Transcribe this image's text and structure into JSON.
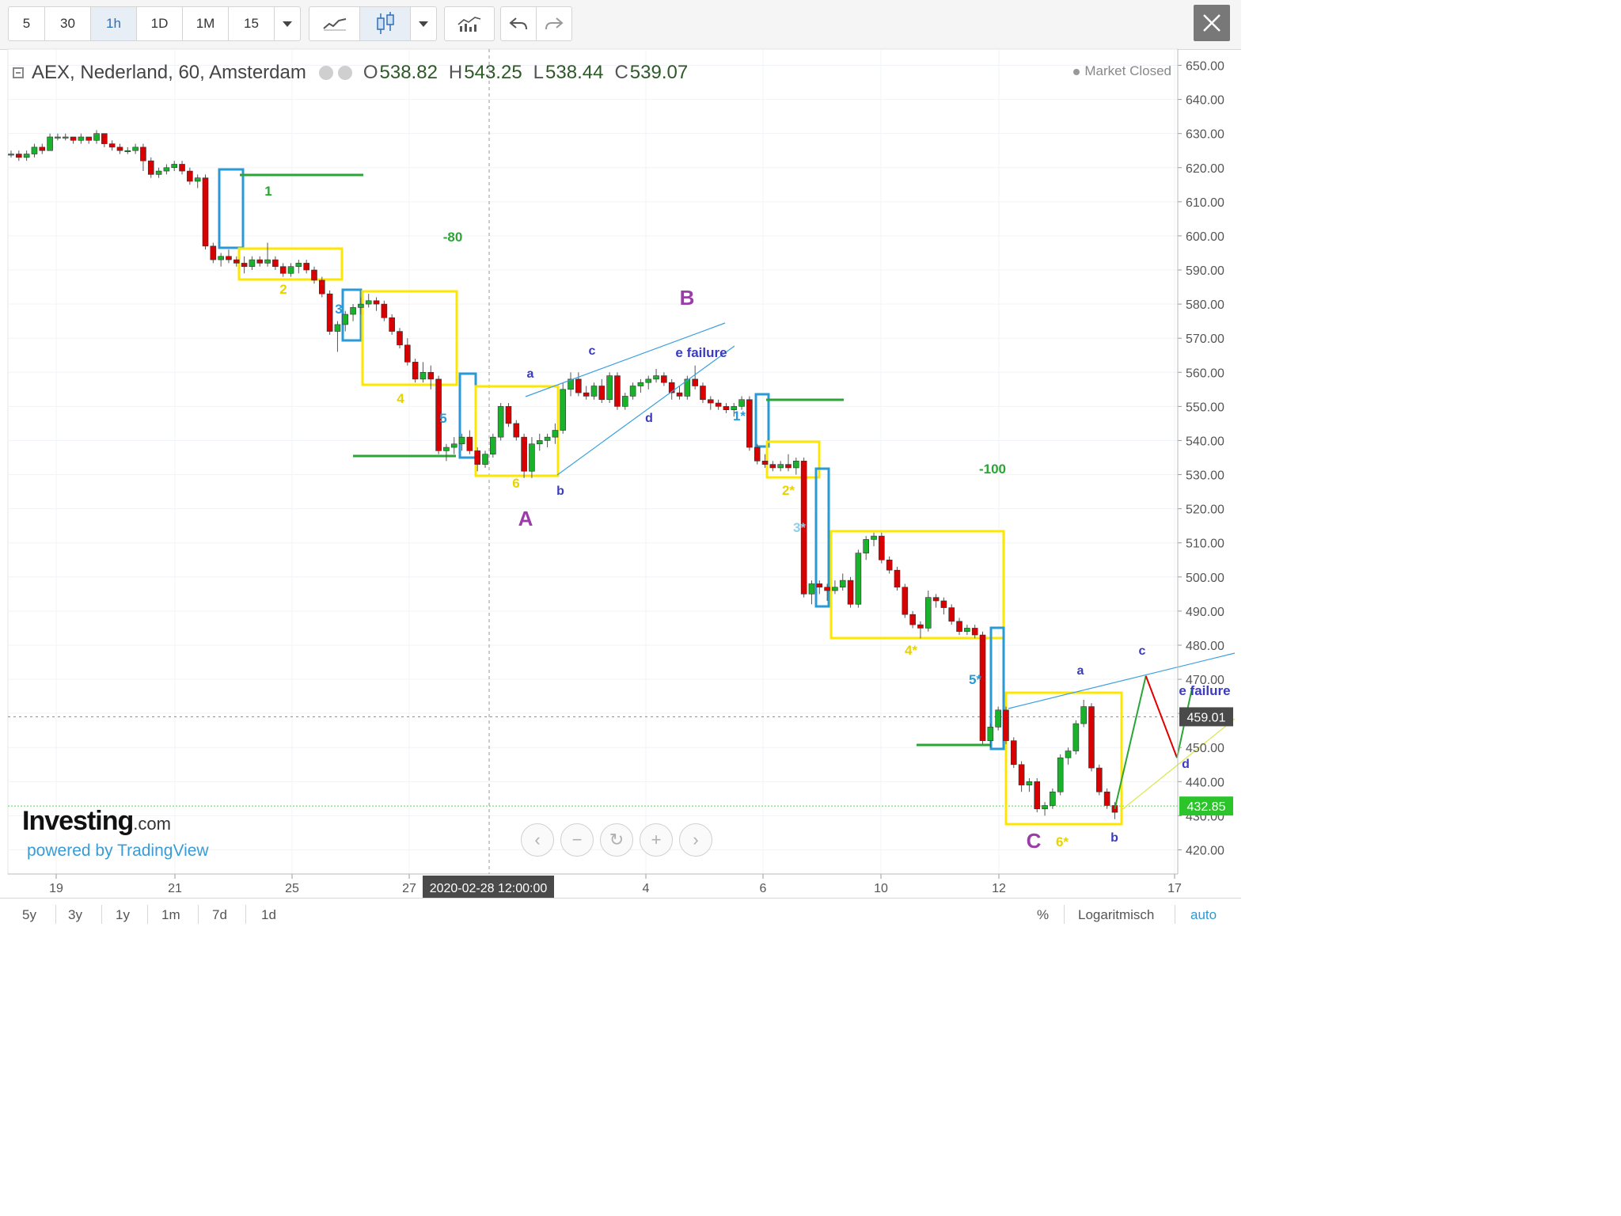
{
  "toolbar": {
    "intervals": [
      "5",
      "30",
      "1h",
      "1D",
      "1M",
      "15"
    ],
    "active_interval": "1h"
  },
  "legend": {
    "title": "AEX, Nederland, 60, Amsterdam",
    "open_label": "O",
    "open": "538.82",
    "high_label": "H",
    "high": "543.25",
    "low_label": "L",
    "low": "538.44",
    "close_label": "C",
    "close": "539.07"
  },
  "status": "Market Closed",
  "branding": {
    "name": "Investing",
    "domain": ".com",
    "powered": "powered by TradingView"
  },
  "bottom": {
    "ranges": [
      "5y",
      "3y",
      "1y",
      "1m",
      "7d",
      "1d"
    ],
    "percent": "%",
    "log": "Logaritmisch",
    "auto": "auto"
  },
  "colors": {
    "up": "#19b22b",
    "down": "#d80000",
    "wave_box": "#ffe600",
    "impulse_box": "#2a9ad6",
    "target_line": "#2aa536"
  },
  "chart_data": {
    "type": "candlestick",
    "y_axis": {
      "min": 415,
      "max": 655,
      "ticks": [
        "650.00",
        "640.00",
        "630.00",
        "620.00",
        "610.00",
        "600.00",
        "590.00",
        "580.00",
        "570.00",
        "560.00",
        "550.00",
        "540.00",
        "530.00",
        "520.00",
        "510.00",
        "500.00",
        "490.00",
        "480.00",
        "470.00",
        "460.00",
        "450.00",
        "440.00",
        "430.00",
        "420.00"
      ],
      "log_scale": true,
      "grid": true
    },
    "x_axis": {
      "ticks": [
        "19",
        "21",
        "25",
        "27",
        "4",
        "6",
        "10",
        "12",
        "17"
      ],
      "crosshair_label": "2020-02-28 12:00:00"
    },
    "price_labels": {
      "last": "459.01",
      "marker": "432.85"
    },
    "candles": [
      [
        0,
        624,
        625,
        623,
        624
      ],
      [
        1,
        624,
        625,
        622,
        623
      ],
      [
        2,
        623,
        625,
        622,
        624
      ],
      [
        3,
        624,
        627,
        623,
        626
      ],
      [
        4,
        626,
        627,
        624,
        625
      ],
      [
        5,
        625,
        630,
        625,
        629
      ],
      [
        6,
        629,
        630,
        628,
        629
      ],
      [
        7,
        629,
        630,
        628,
        629
      ],
      [
        8,
        629,
        629,
        627,
        628
      ],
      [
        9,
        628,
        630,
        627,
        629
      ],
      [
        10,
        629,
        629,
        627,
        628
      ],
      [
        11,
        628,
        631,
        627,
        630
      ],
      [
        12,
        630,
        630,
        626,
        627
      ],
      [
        13,
        627,
        628,
        625,
        626
      ],
      [
        14,
        626,
        627,
        624,
        625
      ],
      [
        15,
        625,
        626,
        624,
        625
      ],
      [
        16,
        625,
        627,
        624,
        626
      ],
      [
        17,
        626,
        627,
        619,
        622
      ],
      [
        18,
        622,
        623,
        617,
        618
      ],
      [
        19,
        618,
        620,
        617,
        619
      ],
      [
        20,
        619,
        621,
        618,
        620
      ],
      [
        21,
        620,
        622,
        619,
        621
      ],
      [
        22,
        621,
        622,
        618,
        619
      ],
      [
        23,
        619,
        620,
        615,
        616
      ],
      [
        24,
        616,
        618,
        614,
        617
      ],
      [
        25,
        617,
        618,
        596,
        597
      ],
      [
        26,
        597,
        598,
        592,
        593
      ],
      [
        27,
        593,
        595,
        591,
        594
      ],
      [
        28,
        594,
        596,
        592,
        593
      ],
      [
        29,
        593,
        594,
        591,
        592
      ],
      [
        30,
        592,
        594,
        589,
        591
      ],
      [
        31,
        591,
        594,
        590,
        593
      ],
      [
        32,
        593,
        594,
        591,
        592
      ],
      [
        33,
        592,
        598,
        591,
        593
      ],
      [
        34,
        593,
        594,
        590,
        591
      ],
      [
        35,
        591,
        592,
        588,
        589
      ],
      [
        36,
        589,
        592,
        588,
        591
      ],
      [
        37,
        591,
        593,
        589,
        592
      ],
      [
        38,
        592,
        593,
        589,
        590
      ],
      [
        39,
        590,
        591,
        586,
        587
      ],
      [
        40,
        587,
        588,
        582,
        583
      ],
      [
        41,
        583,
        584,
        571,
        572
      ],
      [
        42,
        572,
        575,
        566,
        574
      ],
      [
        43,
        574,
        578,
        572,
        577
      ],
      [
        44,
        577,
        580,
        575,
        579
      ],
      [
        45,
        579,
        582,
        577,
        580
      ],
      [
        46,
        580,
        583,
        579,
        581
      ],
      [
        47,
        581,
        582,
        578,
        580
      ],
      [
        48,
        580,
        581,
        575,
        576
      ],
      [
        49,
        576,
        577,
        571,
        572
      ],
      [
        50,
        572,
        573,
        567,
        568
      ],
      [
        51,
        568,
        570,
        562,
        563
      ],
      [
        52,
        563,
        564,
        557,
        558
      ],
      [
        53,
        558,
        563,
        557,
        560
      ],
      [
        54,
        560,
        562,
        555,
        558
      ],
      [
        55,
        558,
        559,
        536,
        537
      ],
      [
        56,
        537,
        539,
        534,
        538
      ],
      [
        57,
        538,
        541,
        536,
        539
      ],
      [
        58,
        539,
        542,
        537,
        541
      ],
      [
        59,
        541,
        543,
        536,
        537
      ],
      [
        60,
        537,
        538,
        531,
        533
      ],
      [
        61,
        533,
        537,
        532,
        536
      ],
      [
        62,
        536,
        542,
        535,
        541
      ],
      [
        63,
        541,
        551,
        540,
        550
      ],
      [
        64,
        550,
        551,
        544,
        545
      ],
      [
        65,
        545,
        546,
        540,
        541
      ],
      [
        66,
        541,
        542,
        529,
        531
      ],
      [
        67,
        531,
        541,
        529,
        539
      ],
      [
        68,
        539,
        542,
        537,
        540
      ],
      [
        69,
        540,
        542,
        538,
        541
      ],
      [
        70,
        541,
        545,
        539,
        543
      ],
      [
        71,
        543,
        557,
        542,
        555
      ],
      [
        72,
        555,
        560,
        553,
        558
      ],
      [
        73,
        558,
        560,
        553,
        554
      ],
      [
        74,
        554,
        556,
        552,
        553
      ],
      [
        75,
        553,
        557,
        552,
        556
      ],
      [
        76,
        556,
        558,
        551,
        552
      ],
      [
        77,
        552,
        560,
        551,
        559
      ],
      [
        78,
        559,
        560,
        549,
        550
      ],
      [
        79,
        550,
        554,
        549,
        553
      ],
      [
        80,
        553,
        557,
        552,
        556
      ],
      [
        81,
        556,
        558,
        554,
        557
      ],
      [
        82,
        557,
        559,
        555,
        558
      ],
      [
        83,
        558,
        561,
        557,
        559
      ],
      [
        84,
        559,
        560,
        556,
        557
      ],
      [
        85,
        557,
        558,
        552,
        554
      ],
      [
        86,
        554,
        556,
        552,
        553
      ],
      [
        87,
        553,
        559,
        552,
        558
      ],
      [
        88,
        558,
        562,
        555,
        556
      ],
      [
        89,
        556,
        557,
        551,
        552
      ],
      [
        90,
        552,
        553,
        549,
        551
      ],
      [
        91,
        551,
        552,
        549,
        550
      ],
      [
        92,
        550,
        551,
        548,
        549
      ],
      [
        93,
        549,
        551,
        547,
        550
      ],
      [
        94,
        550,
        553,
        549,
        552
      ],
      [
        95,
        552,
        553,
        537,
        538
      ],
      [
        96,
        538,
        539,
        533,
        534
      ],
      [
        97,
        534,
        536,
        532,
        533
      ],
      [
        98,
        533,
        534,
        531,
        532
      ],
      [
        99,
        532,
        534,
        531,
        533
      ],
      [
        100,
        533,
        536,
        531,
        532
      ],
      [
        101,
        532,
        535,
        530,
        534
      ],
      [
        102,
        534,
        535,
        494,
        495
      ],
      [
        103,
        495,
        499,
        492,
        498
      ],
      [
        104,
        498,
        499,
        495,
        497
      ],
      [
        105,
        497,
        498,
        493,
        496
      ],
      [
        106,
        496,
        499,
        495,
        497
      ],
      [
        107,
        497,
        501,
        496,
        499
      ],
      [
        108,
        499,
        500,
        491,
        492
      ],
      [
        109,
        492,
        508,
        491,
        507
      ],
      [
        110,
        507,
        512,
        505,
        511
      ],
      [
        111,
        511,
        513,
        509,
        512
      ],
      [
        112,
        512,
        513,
        504,
        505
      ],
      [
        113,
        505,
        506,
        501,
        502
      ],
      [
        114,
        502,
        503,
        496,
        497
      ],
      [
        115,
        497,
        498,
        488,
        489
      ],
      [
        116,
        489,
        490,
        485,
        486
      ],
      [
        117,
        486,
        487,
        482,
        485
      ],
      [
        118,
        485,
        496,
        484,
        494
      ],
      [
        119,
        494,
        495,
        491,
        493
      ],
      [
        120,
        493,
        494,
        489,
        491
      ],
      [
        121,
        491,
        492,
        486,
        487
      ],
      [
        122,
        487,
        488,
        483,
        484
      ],
      [
        123,
        484,
        486,
        483,
        485
      ],
      [
        124,
        485,
        486,
        482,
        483
      ],
      [
        125,
        483,
        484,
        451,
        452
      ],
      [
        126,
        452,
        457,
        450,
        456
      ],
      [
        127,
        456,
        462,
        455,
        461
      ],
      [
        128,
        461,
        462,
        451,
        452
      ],
      [
        129,
        452,
        453,
        444,
        445
      ],
      [
        130,
        445,
        446,
        437,
        439
      ],
      [
        131,
        439,
        441,
        437,
        440
      ],
      [
        132,
        440,
        441,
        431,
        432
      ],
      [
        133,
        432,
        434,
        430,
        433
      ],
      [
        134,
        433,
        438,
        432,
        437
      ],
      [
        135,
        437,
        448,
        436,
        447
      ],
      [
        136,
        447,
        450,
        445,
        449
      ],
      [
        137,
        449,
        458,
        448,
        457
      ],
      [
        138,
        457,
        464,
        456,
        462
      ],
      [
        139,
        462,
        463,
        443,
        444
      ],
      [
        140,
        444,
        445,
        436,
        437
      ],
      [
        141,
        437,
        438,
        432,
        433
      ],
      [
        142,
        433,
        434,
        429,
        431
      ]
    ],
    "projection": {
      "up": [
        [
          142,
          432
        ],
        [
          146,
          471
        ]
      ],
      "down": [
        [
          146,
          471
        ],
        [
          150,
          447
        ]
      ],
      "up2": [
        [
          150,
          447
        ],
        [
          152,
          468
        ]
      ]
    },
    "annotations": [
      {
        "text": "1",
        "color": "#2aa536"
      },
      {
        "text": "2",
        "color": "#e8d200"
      },
      {
        "text": "3",
        "color": "#2a9ad6"
      },
      {
        "text": "4",
        "color": "#e8d200"
      },
      {
        "text": "5",
        "color": "#2a9ad6"
      },
      {
        "text": "6",
        "color": "#e8d200"
      },
      {
        "text": "-80",
        "color": "#2aa536"
      },
      {
        "text": "A",
        "color": "#9b3ca8"
      },
      {
        "text": "B",
        "color": "#9b3ca8"
      },
      {
        "text": "a",
        "color": "#3b3bbd"
      },
      {
        "text": "b",
        "color": "#3b3bbd"
      },
      {
        "text": "c",
        "color": "#3b3bbd"
      },
      {
        "text": "d",
        "color": "#3b3bbd"
      },
      {
        "text": "e failure",
        "color": "#3b3bbd"
      },
      {
        "text": "1*",
        "color": "#2a9ad6"
      },
      {
        "text": "2*",
        "color": "#e8d200"
      },
      {
        "text": "3*",
        "color": "#8fcfe8"
      },
      {
        "text": "4*",
        "color": "#e8d200"
      },
      {
        "text": "5*",
        "color": "#2a9ad6"
      },
      {
        "text": "6*",
        "color": "#e8d200"
      },
      {
        "text": "-100",
        "color": "#2aa536"
      },
      {
        "text": "C",
        "color": "#9b3ca8"
      },
      {
        "text": "a",
        "color": "#3b3bbd"
      },
      {
        "text": "b",
        "color": "#3b3bbd"
      },
      {
        "text": "c",
        "color": "#3b3bbd"
      },
      {
        "text": "d",
        "color": "#3b3bbd"
      },
      {
        "text": "e failure",
        "color": "#3b3bbd"
      }
    ]
  }
}
